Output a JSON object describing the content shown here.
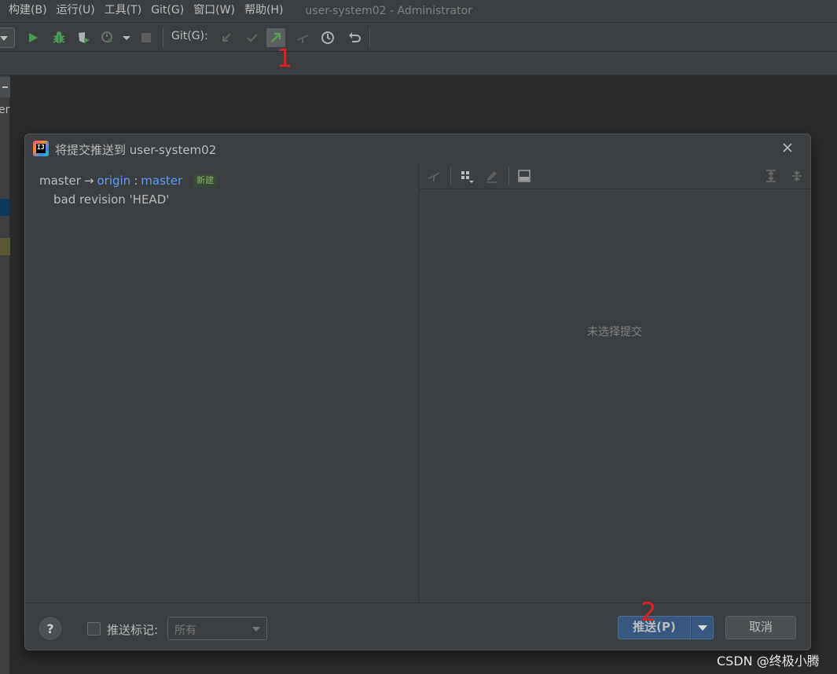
{
  "menubar": {
    "items": [
      "构建(B)",
      "运行(U)",
      "工具(T)",
      "Git(G)",
      "窗口(W)",
      "帮助(H)"
    ],
    "window_title": "user-system02 - Administrator"
  },
  "toolbar": {
    "git_label": "Git(G):",
    "icons": [
      "run-icon",
      "debug-icon",
      "coverage-icon",
      "profile-icon",
      "dropdown-arrow-icon",
      "stop-icon",
      "update-project-icon",
      "commit-check-icon",
      "push-arrow-icon",
      "merge-icon",
      "history-clock-icon",
      "rollback-icon"
    ]
  },
  "left_strip": {
    "text": "er"
  },
  "dialog": {
    "title": "将提交推送到 user-system02",
    "logo_text": "IJ",
    "push": {
      "local_branch": "master",
      "arrow": "→",
      "remote": "origin",
      "colon": ":",
      "remote_branch": "master",
      "badge": "新建",
      "message": "bad revision 'HEAD'"
    },
    "details": {
      "empty_text": "未选择提交",
      "toolbar_icons": [
        "cherry-pick-icon",
        "group-icon",
        "edit-icon",
        "preview-icon",
        "expand-all-icon",
        "collapse-all-icon"
      ]
    },
    "footer": {
      "help": "?",
      "push_tags_label": "推送标记:",
      "push_tags_checked": false,
      "tags_select_value": "所有",
      "push_button": "推送(P)",
      "cancel_button": "取消"
    }
  },
  "annotations": {
    "step1": "1",
    "step2": "2"
  },
  "watermark": "CSDN @终极小腾",
  "colors": {
    "background": "#2b2b2b",
    "panel": "#3c3f41",
    "link": "#589df6",
    "primary_button": "#365880",
    "annotation": "#e02020"
  }
}
